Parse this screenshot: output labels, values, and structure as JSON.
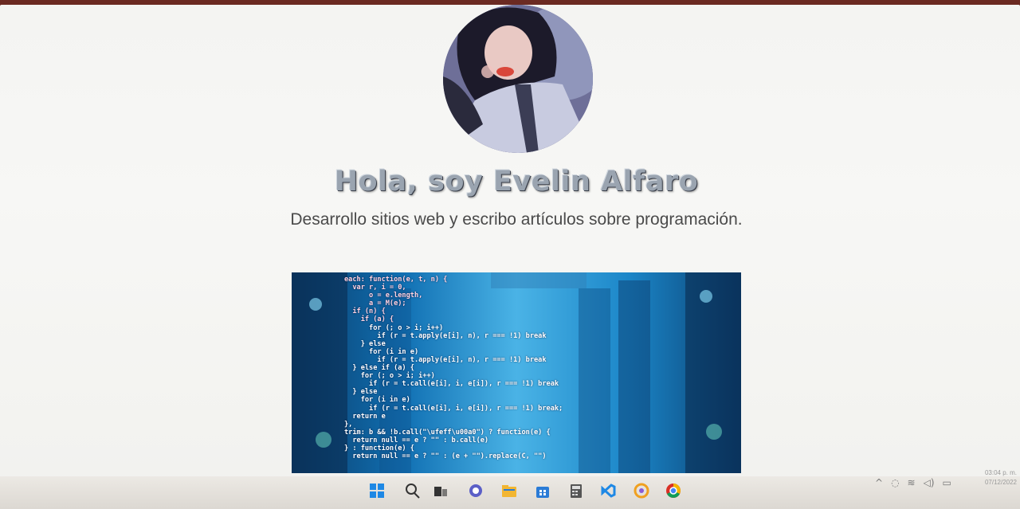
{
  "profile": {
    "title": "Hola, soy Evelin Alfaro",
    "subtitle": "Desarrollo sitios web y escribo artículos sobre programación."
  },
  "code_image": {
    "lines": [
      "each: function(e, t, n) {",
      "  var r, i = 0,",
      "      o = e.length,",
      "      a = M(e);",
      "  if (n) {",
      "    if (a) {",
      "      for (; o > i; i++)",
      "        if (r = t.apply(e[i], n), r === !1) break",
      "    } else",
      "      for (i in e)",
      "        if (r = t.apply(e[i], n), r === !1) break",
      "  } else if (a) {",
      "    for (; o > i; i++)",
      "      if (r = t.call(e[i], i, e[i]), r === !1) break",
      "  } else",
      "    for (i in e)",
      "      if (r = t.call(e[i], i, e[i]), r === !1) break;",
      "  return e",
      "},",
      "trim: b && !b.call(\"\\ufeff\\u00a0\") ? function(e) {",
      "  return null == e ? \"\" : b.call(e)",
      "} : function(e) {",
      "  return null == e ? \"\" : (e + \"\").replace(C, \"\")"
    ]
  },
  "taskbar": {
    "apps": [
      {
        "name": "windows-start-icon",
        "color": "#1e88e5"
      },
      {
        "name": "search-icon",
        "color": "#333333"
      },
      {
        "name": "task-view-icon",
        "color": "#333333"
      },
      {
        "name": "chat-icon",
        "color": "#5b5fc7"
      },
      {
        "name": "file-explorer-icon",
        "color": "#f2b632"
      },
      {
        "name": "store-icon",
        "color": "#2a7bd6"
      },
      {
        "name": "calculator-icon",
        "color": "#555555"
      },
      {
        "name": "vscode-icon",
        "color": "#1e88e5"
      },
      {
        "name": "app-icon",
        "color": "#f0a020"
      },
      {
        "name": "chrome-icon",
        "color": "#d93025"
      }
    ],
    "clock": {
      "time": "03:04 p. m.",
      "date": "07/12/2022"
    }
  }
}
